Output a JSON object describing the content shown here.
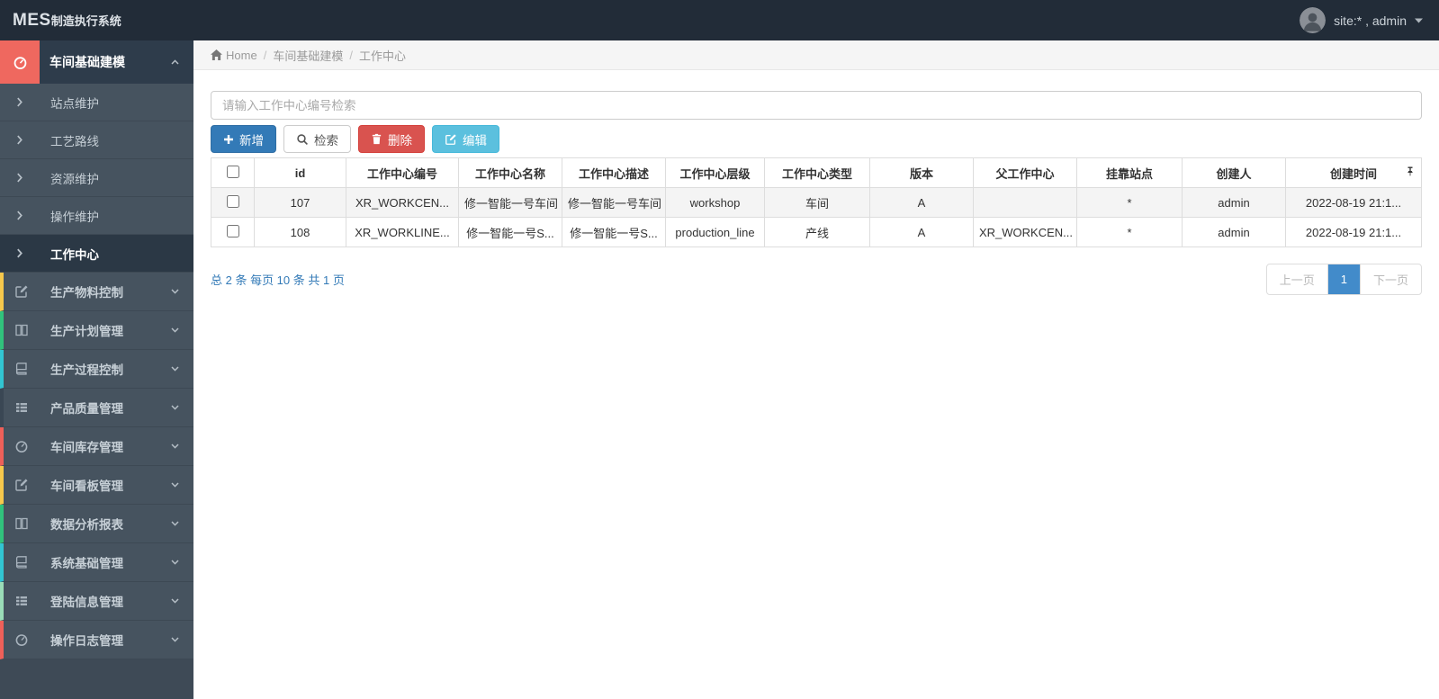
{
  "topbar": {
    "logo_primary": "MES",
    "logo_secondary": "制造执行系统",
    "user": "site:* , admin"
  },
  "breadcrumb": {
    "separator": "/",
    "items": [
      {
        "label": "Home"
      },
      {
        "label": "车间基础建模"
      },
      {
        "label": "工作中心"
      }
    ]
  },
  "sidebar": {
    "group": {
      "label": "车间基础建模",
      "icon": "gauge-icon",
      "accent": "#ef685f"
    },
    "submenu": [
      {
        "label": "站点维护"
      },
      {
        "label": "工艺路线"
      },
      {
        "label": "资源维护"
      },
      {
        "label": "操作维护"
      },
      {
        "label": "工作中心",
        "active": true
      }
    ],
    "sections": [
      {
        "label": "生产物料控制",
        "icon": "edit-icon",
        "color": "#f6c84c"
      },
      {
        "label": "生产计划管理",
        "icon": "columns-icon",
        "color": "#31c27c"
      },
      {
        "label": "生产过程控制",
        "icon": "book-icon",
        "color": "#32c5d2"
      },
      {
        "label": "产品质量管理",
        "icon": "list-icon",
        "color": "#3a4754"
      },
      {
        "label": "车间库存管理",
        "icon": "gauge-icon",
        "color": "#ee6059"
      },
      {
        "label": "车间看板管理",
        "icon": "edit-icon",
        "color": "#f6c84c"
      },
      {
        "label": "数据分析报表",
        "icon": "columns-icon",
        "color": "#31c27c"
      },
      {
        "label": "系统基础管理",
        "icon": "book-icon",
        "color": "#32c5d2"
      },
      {
        "label": "登陆信息管理",
        "icon": "list-icon",
        "color": "#9adcb7"
      },
      {
        "label": "操作日志管理",
        "icon": "gauge-icon",
        "color": "#ee6059"
      }
    ]
  },
  "search": {
    "placeholder": "请输入工作中心编号检索",
    "value": ""
  },
  "toolbar": {
    "add": "新增",
    "search": "检索",
    "delete": "删除",
    "edit": "编辑"
  },
  "table": {
    "columns": [
      "id",
      "工作中心编号",
      "工作中心名称",
      "工作中心描述",
      "工作中心层级",
      "工作中心类型",
      "版本",
      "父工作中心",
      "挂靠站点",
      "创建人",
      "创建时间"
    ],
    "rows": [
      {
        "cells": [
          "107",
          "XR_WORKCEN...",
          "修一智能一号车间",
          "修一智能一号车间",
          "workshop",
          "车间",
          "A",
          "",
          "*",
          "admin",
          "2022-08-19 21:1..."
        ]
      },
      {
        "cells": [
          "108",
          "XR_WORKLINE...",
          "修一智能一号S...",
          "修一智能一号S...",
          "production_line",
          "产线",
          "A",
          "XR_WORKCEN...",
          "*",
          "admin",
          "2022-08-19 21:1..."
        ]
      }
    ]
  },
  "footer": {
    "stats": "总 2 条  每页 10 条  共 1 页",
    "prev": "上一页",
    "page": "1",
    "next": "下一页"
  },
  "colors": {
    "primary": "#337ab7",
    "danger": "#d9534f",
    "info": "#5bc0de",
    "page_active": "#428bca",
    "link": "#337ab7",
    "sidebar_accent": "#ef685f"
  }
}
